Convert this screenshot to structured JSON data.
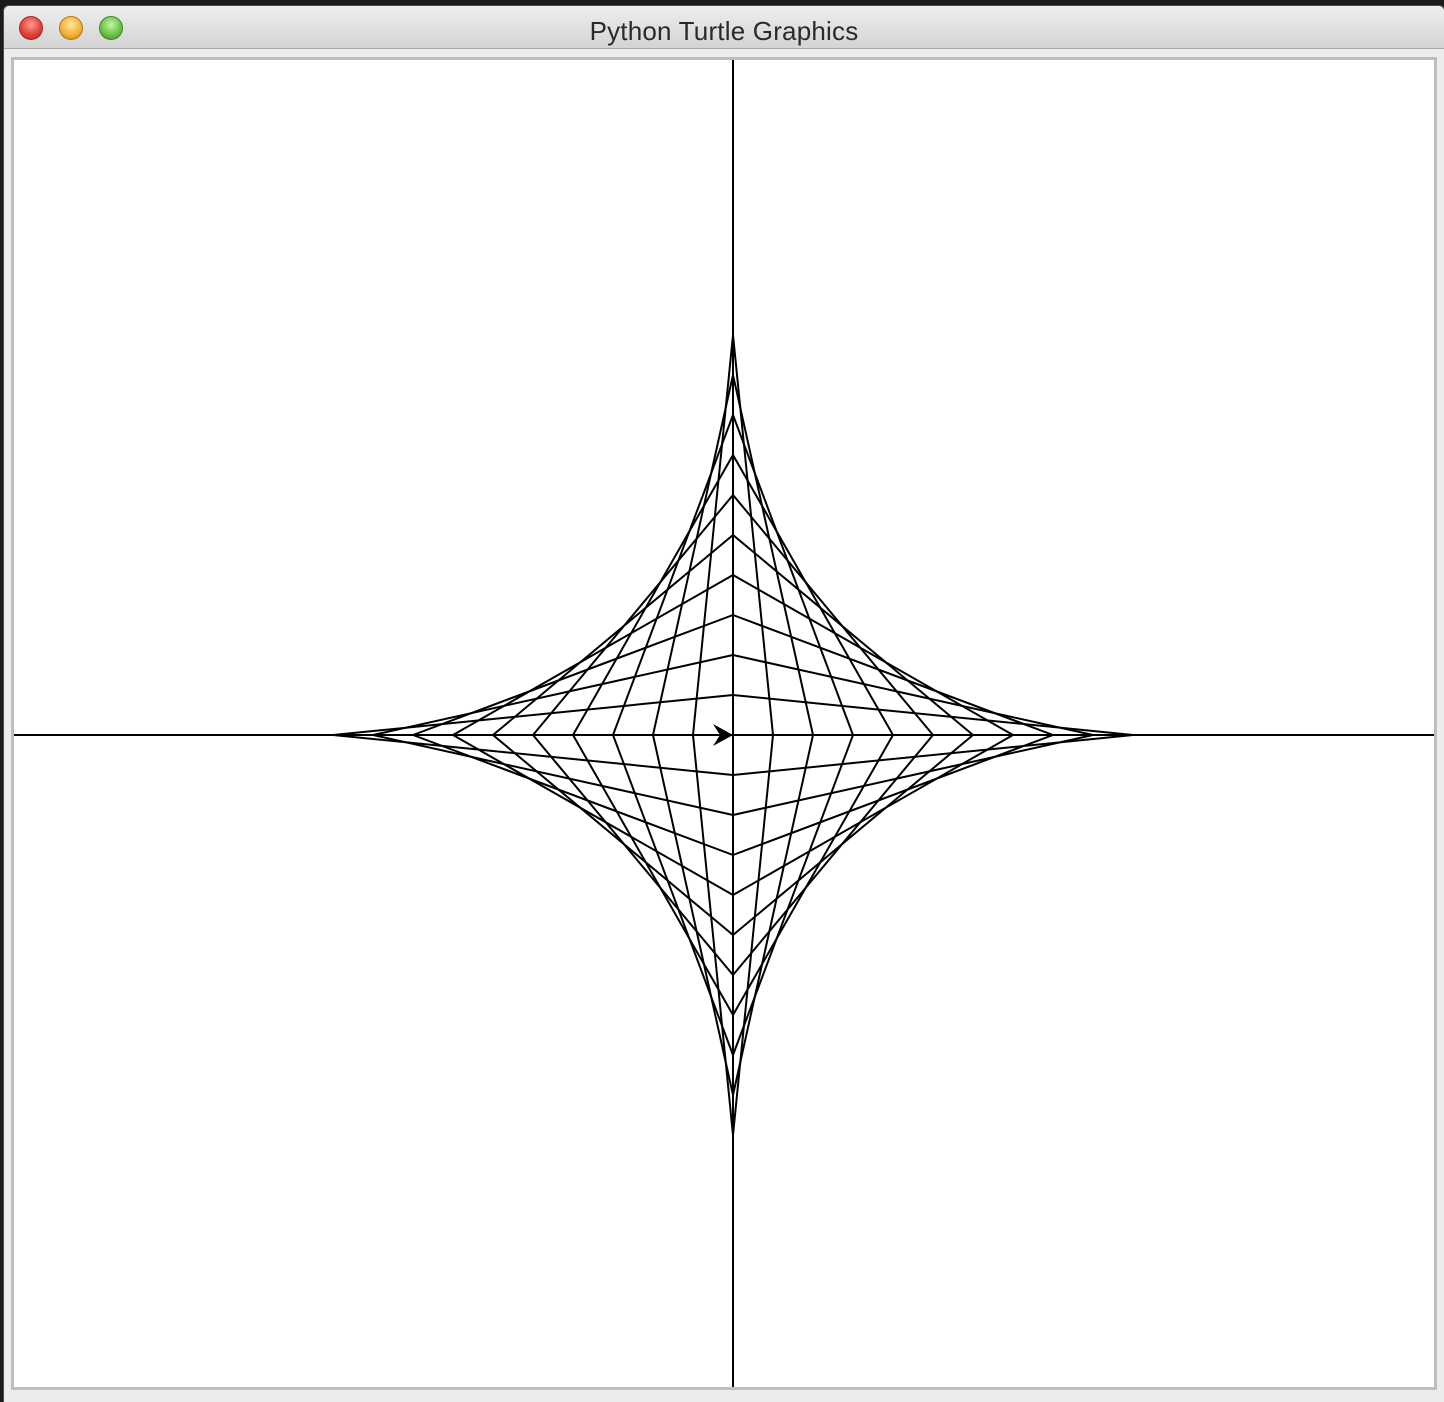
{
  "window": {
    "title": "Python Turtle Graphics"
  },
  "controls": {
    "close": "close-button",
    "minimize": "minimize-button",
    "zoom": "zoom-button"
  },
  "drawing": {
    "stroke_color": "#000000",
    "background_color": "#ffffff",
    "pattern": "string-art astroid",
    "lines_per_quadrant": 10,
    "turtle_heading": "east"
  }
}
